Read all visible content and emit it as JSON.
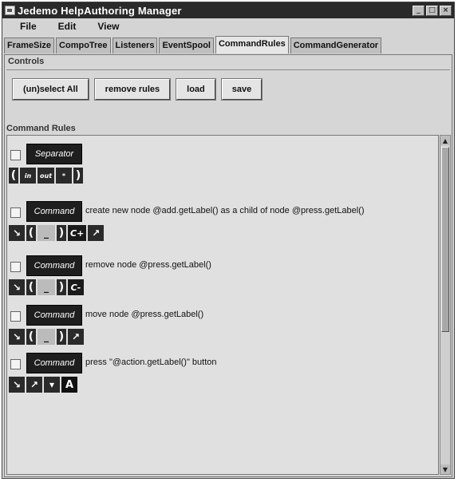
{
  "window": {
    "title": "Jedemo HelpAuthoring Manager",
    "buttons": [
      "_",
      "□",
      "×"
    ]
  },
  "menu": {
    "items": [
      "File",
      "Edit",
      "View"
    ]
  },
  "tabs": {
    "items": [
      "FrameSize",
      "CompoTree",
      "Listeners",
      "EventSpool",
      "CommandRules",
      "CommandGenerator"
    ],
    "active_index": 4
  },
  "controls": {
    "label": "Controls",
    "buttons": [
      "(un)select All",
      "remove rules",
      "load",
      "save"
    ]
  },
  "rules": {
    "label": "Command Rules",
    "items": [
      {
        "badge": "Separator",
        "text": "",
        "tokens": [
          "(",
          "in",
          "out",
          "*",
          ")"
        ]
      },
      {
        "badge": "Command",
        "text": "create new node @add.getLabel() as a child of node @press.getLabel()",
        "tokens": [
          "↘",
          "(",
          "_",
          ")",
          "C+",
          "↗"
        ]
      },
      {
        "badge": "Command",
        "text": "remove node @press.getLabel()",
        "tokens": [
          "↘",
          "(",
          "_",
          ")",
          "C-"
        ]
      },
      {
        "badge": "Command",
        "text": "move node @press.getLabel()",
        "tokens": [
          "↘",
          "(",
          "_",
          ")",
          "↗"
        ]
      },
      {
        "badge": "Command",
        "text": "press \"@action.getLabel()\" button",
        "tokens": [
          "↘",
          "↗",
          "▾",
          "A"
        ]
      }
    ]
  }
}
